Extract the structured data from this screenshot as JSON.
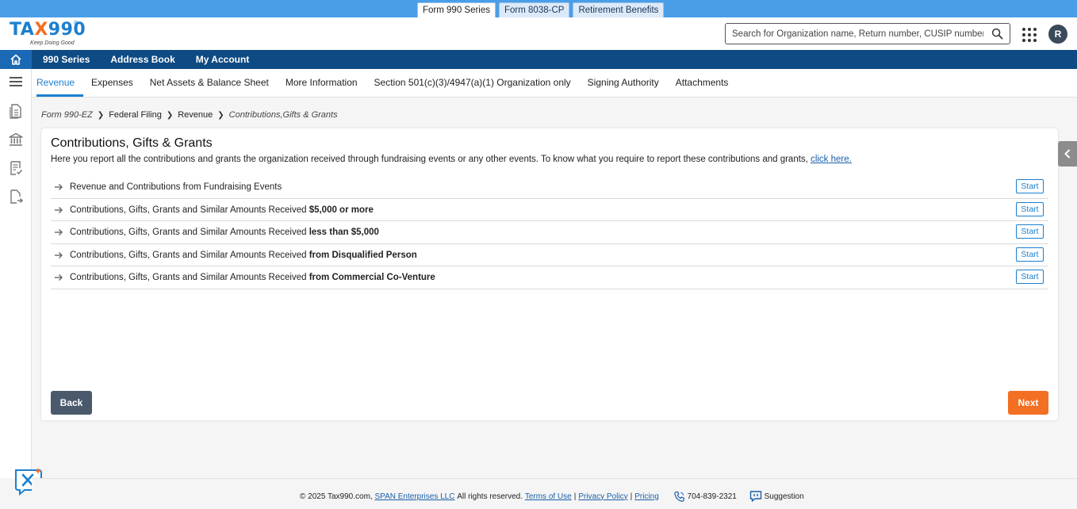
{
  "product_tabs": [
    "Form 990 Series",
    "Form 8038-CP",
    "Retirement Benefits"
  ],
  "logo": {
    "text_main": "TA",
    "text_x": "X",
    "text_end": "990",
    "registered": "®",
    "tagline": "Keep Doing Good"
  },
  "search": {
    "placeholder": "Search for Organization name, Return number, CUSIP number"
  },
  "user": {
    "initial": "R"
  },
  "nav": {
    "items": [
      "990 Series",
      "Address Book",
      "My Account"
    ]
  },
  "section_tabs": [
    "Revenue",
    "Expenses",
    "Net Assets & Balance Sheet",
    "More Information",
    "Section 501(c)(3)/4947(a)(1) Organization only",
    "Signing Authority",
    "Attachments"
  ],
  "breadcrumb": {
    "form": "Form 990-EZ",
    "filing": "Federal Filing",
    "section": "Revenue",
    "current": "Contributions,Gifts & Grants"
  },
  "card": {
    "title": "Contributions, Gifts & Grants",
    "description": "Here you report all the contributions and grants the organization received through fundraising events or any other events. To know what you require to report these contributions and grants,",
    "link_text": "click here.",
    "rows": [
      {
        "prefix": "Revenue and Contributions from Fundraising Events",
        "bold": ""
      },
      {
        "prefix": "Contributions, Gifts, Grants and Similar Amounts Received ",
        "bold": "$5,000 or more"
      },
      {
        "prefix": "Contributions, Gifts, Grants and Similar Amounts Received ",
        "bold": "less than $5,000"
      },
      {
        "prefix": "Contributions, Gifts, Grants and Similar Amounts Received ",
        "bold": "from Disqualified Person"
      },
      {
        "prefix": "Contributions, Gifts, Grants and Similar Amounts Received ",
        "bold": "from Commercial Co-Venture"
      }
    ],
    "start_label": "Start",
    "back_label": "Back",
    "next_label": "Next"
  },
  "footer": {
    "copyright": "© 2025 Tax990.com,",
    "company": "SPAN Enterprises LLC",
    "rights": "All rights reserved.",
    "terms": "Terms of Use",
    "privacy": "Privacy Policy",
    "pricing": "Pricing",
    "phone": "704-839-2321",
    "suggestion": "Suggestion"
  },
  "colors": {
    "accent": "#1b7fcf",
    "nav": "#0e4a83",
    "next": "#f36f21",
    "back": "#4a5a6c"
  },
  "icons": [
    "home-icon",
    "menu-icon",
    "document-icon",
    "bank-icon",
    "checklist-icon",
    "export-icon",
    "search-icon",
    "apps-grid-icon",
    "arrow-right-icon",
    "chevron-left-icon",
    "phone-icon",
    "suggestion-icon",
    "chat-assistant-icon"
  ]
}
